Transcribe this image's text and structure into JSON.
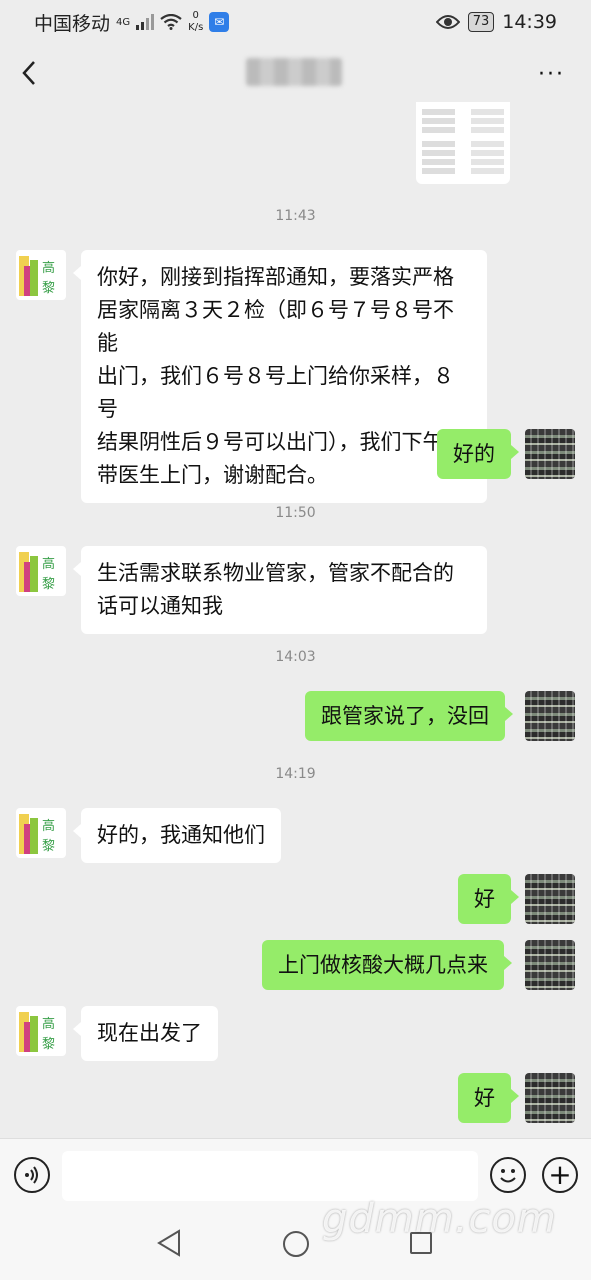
{
  "status_bar": {
    "carrier": "中国移动",
    "network": "4G",
    "speed_value": "0",
    "speed_unit": "K/s",
    "battery": "73",
    "time": "14:39"
  },
  "header": {
    "back_icon": "chevron-left-icon",
    "more_label": "···"
  },
  "messages": [
    {
      "type": "time",
      "text": "11:43"
    },
    {
      "type": "left",
      "text": "你好，刚接到指挥部通知，要落实严格居家隔离3天2检（即6号7号8号不能出门，我们6号8号上门给你采样，8号结果阴性后9号可以出门），我们下午带医生上门，谢谢配合。",
      "lines": [
        "你好，刚接到指挥部通知，要落实严格",
        "居家隔离３天２检（即６号７号８号不能",
        "出门，我们６号８号上门给你采样，８号",
        "结果阴性后９号可以出门），我们下午",
        "带医生上门，谢谢配合。"
      ]
    },
    {
      "type": "right",
      "text": "好的"
    },
    {
      "type": "time",
      "text": "11:50"
    },
    {
      "type": "left",
      "text": "生活需求联系物业管家，管家不配合的话可以通知我",
      "lines": [
        "生活需求联系物业管家，管家不配合的",
        "话可以通知我"
      ]
    },
    {
      "type": "time",
      "text": "14:03"
    },
    {
      "type": "right",
      "text": "跟管家说了，没回"
    },
    {
      "type": "time",
      "text": "14:19"
    },
    {
      "type": "left",
      "text": "好的，我通知他们",
      "lines": [
        "好的，我通知他们"
      ]
    },
    {
      "type": "right",
      "text": "好"
    },
    {
      "type": "right",
      "text": "上门做核酸大概几点来"
    },
    {
      "type": "left",
      "text": "现在出发了",
      "lines": [
        "现在出发了"
      ]
    },
    {
      "type": "right",
      "text": "好"
    }
  ],
  "avatar_left_text": "高黎",
  "input_bar": {
    "voice_icon": "voice-icon",
    "emoji_icon": "emoji-icon",
    "plus_icon": "plus-icon"
  },
  "watermark": "gdmm.com",
  "colors": {
    "background": "#ededed",
    "bubble_self": "#95ec69",
    "bubble_other": "#ffffff"
  }
}
